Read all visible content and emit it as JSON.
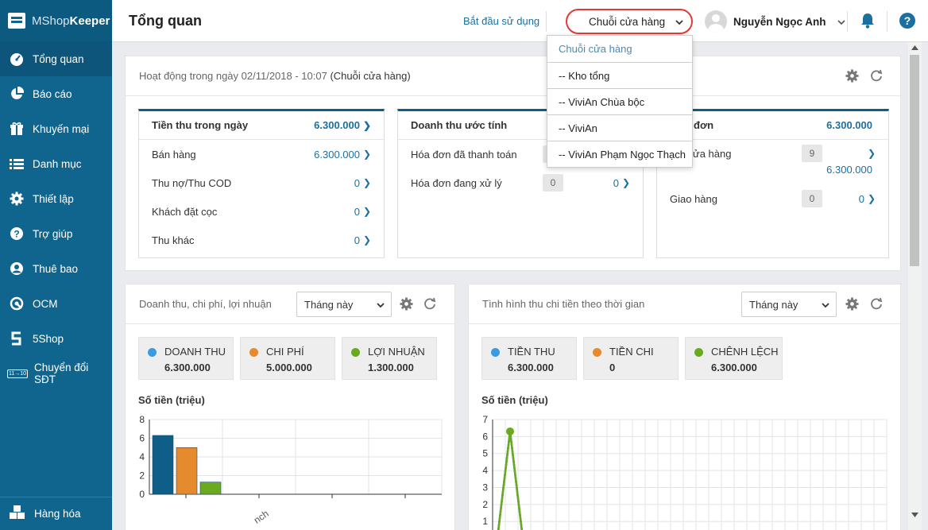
{
  "app": {
    "logo_light": "MShop",
    "logo_bold": "Keeper"
  },
  "sidebar": {
    "items": [
      {
        "label": "Tổng quan",
        "icon": "dashboard-icon"
      },
      {
        "label": "Báo cáo",
        "icon": "pie-chart-icon"
      },
      {
        "label": "Khuyến mại",
        "icon": "gift-icon"
      },
      {
        "label": "Danh mục",
        "icon": "list-icon"
      },
      {
        "label": "Thiết lập",
        "icon": "gear-icon"
      },
      {
        "label": "Trợ giúp",
        "icon": "question-icon"
      },
      {
        "label": "Thuê bao",
        "icon": "user-icon"
      },
      {
        "label": "OCM",
        "icon": "ocm-icon"
      },
      {
        "label": "5Shop",
        "icon": "5shop-icon"
      },
      {
        "label": "Chuyển đổi SĐT",
        "icon": "phone-convert-icon",
        "icon_text": "11→10"
      }
    ],
    "bottom": {
      "label": "Hàng hóa",
      "icon": "boxes-icon"
    }
  },
  "topbar": {
    "title": "Tổng quan",
    "start_link": "Bắt đầu sử dụng",
    "store_select": "Chuỗi cửa hàng",
    "user_name": "Nguyễn Ngọc Anh"
  },
  "dropdown": {
    "options": [
      "Chuỗi cửa hàng",
      "-- Kho tổng",
      "-- ViviAn Chùa bộc",
      "-- ViviAn",
      "-- ViviAn Phạm Ngọc Thạch"
    ]
  },
  "activity": {
    "header_prefix": "Hoạt động trong ngày 02/11/2018 - 10:07",
    "header_scope": "(Chuỗi cửa hàng)",
    "card1": {
      "title": "Tiền thu trong ngày",
      "title_value": "6.300.000",
      "rows": [
        {
          "label": "Bán hàng",
          "value": "6.300.000"
        },
        {
          "label": "Thu nợ/Thu COD",
          "value": "0"
        },
        {
          "label": "Khách đặt cọc",
          "value": "0"
        },
        {
          "label": "Thu khác",
          "value": "0"
        }
      ]
    },
    "card2": {
      "title": "Doanh thu ước tính",
      "rows": [
        {
          "label": "Hóa đơn đã thanh toán",
          "count": "",
          "value": ""
        },
        {
          "label": "Hóa đơn đang xử lý",
          "count": "0",
          "value": "0"
        }
      ]
    },
    "card3": {
      "title": "đơn",
      "title_value": "6.300.000",
      "rows": [
        {
          "label": "ửa hàng",
          "count": "9",
          "value": "6.300.000"
        },
        {
          "label": "Giao hàng",
          "count": "0",
          "value": "0"
        }
      ]
    }
  },
  "revenue_panel": {
    "title": "Doanh thu, chi phí, lợi nhuận",
    "period": "Tháng này",
    "stats": [
      {
        "label": "DOANH THU",
        "value": "6.300.000",
        "color": "#3c9be0"
      },
      {
        "label": "CHI PHÍ",
        "value": "5.000.000",
        "color": "#e58a2d"
      },
      {
        "label": "LỢI NHUẬN",
        "value": "1.300.000",
        "color": "#6aaa1e"
      }
    ],
    "axis_title": "Số tiền (triệu)"
  },
  "cashflow_panel": {
    "title": "Tình hình thu chi tiền theo thời gian",
    "period": "Tháng này",
    "stats": [
      {
        "label": "TIỀN THU",
        "value": "6.300.000",
        "color": "#3c9be0"
      },
      {
        "label": "TIỀN CHI",
        "value": "0",
        "color": "#e58a2d"
      },
      {
        "label": "CHÊNH LỆCH",
        "value": "6.300.000",
        "color": "#6aaa1e"
      }
    ],
    "axis_title": "Số tiền (triệu)"
  },
  "chart_data": [
    {
      "type": "bar",
      "ylabel": "Số tiền (triệu)",
      "ylim": [
        0,
        8
      ],
      "yticks": [
        "0",
        "2",
        "4",
        "6",
        "8"
      ],
      "categories": [
        "ViviAn Phạm Ngọc Thạch"
      ],
      "category_label_visible": "nch",
      "series": [
        {
          "name": "DOANH THU",
          "values": [
            6.3
          ],
          "color": "#0f5e87"
        },
        {
          "name": "CHI PHÍ",
          "values": [
            5.0
          ],
          "color": "#e58a2d"
        },
        {
          "name": "LỢI NHUẬN",
          "values": [
            1.3
          ],
          "color": "#6aaa1e"
        }
      ],
      "grid": true
    },
    {
      "type": "line",
      "ylabel": "Số tiền (triệu)",
      "ylim": [
        0,
        7
      ],
      "yticks": [
        "1",
        "2",
        "3",
        "4",
        "5",
        "6",
        "7"
      ],
      "series": [
        {
          "name": "TIỀN THU",
          "x": [
            0,
            1,
            2
          ],
          "values": [
            0,
            6.3,
            0
          ],
          "color": "#0f5e87"
        },
        {
          "name": "CHÊNH LỆCH",
          "x": [
            0,
            1,
            2
          ],
          "values": [
            0,
            6.3,
            0
          ],
          "color": "#6aaa1e"
        }
      ],
      "grid": true
    }
  ]
}
